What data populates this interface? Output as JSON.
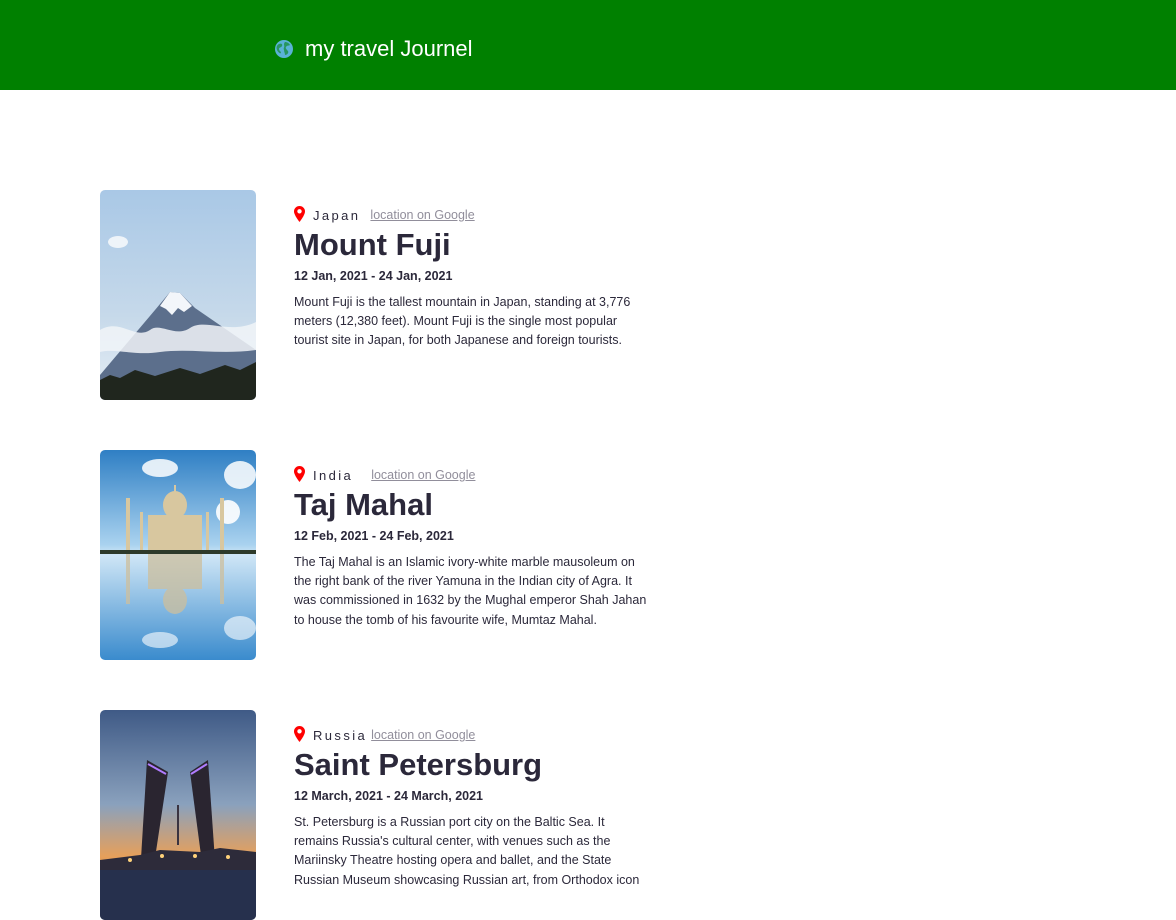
{
  "header": {
    "title": "my travel Journel",
    "icon": "globe-icon",
    "background_color": "#008000"
  },
  "entries": [
    {
      "country": "Japan",
      "map_link": "location on Google",
      "title": "Mount Fuji",
      "dates": "12 Jan, 2021 - 24 Jan, 2021",
      "description": "Mount Fuji is the tallest mountain in Japan, standing at 3,776 meters (12,380 feet). Mount Fuji is the single most popular tourist site in Japan, for both Japanese and foreign tourists.",
      "image": "mount-fuji-photo"
    },
    {
      "country": "India",
      "map_link": "location on Google",
      "title": "Taj Mahal",
      "dates": "12 Feb, 2021 - 24 Feb, 2021",
      "description": "The Taj Mahal is an Islamic ivory-white marble mausoleum on the right bank of the river Yamuna in the Indian city of Agra. It was commissioned in 1632 by the Mughal emperor Shah Jahan to house the tomb of his favourite wife, Mumtaz Mahal.",
      "image": "taj-mahal-photo"
    },
    {
      "country": "Russia",
      "map_link": "location on Google",
      "title": "Saint Petersburg",
      "dates": "12 March, 2021 - 24 March, 2021",
      "description": "St. Petersburg is a Russian port city on the Baltic Sea. It remains Russia's cultural center, with venues such as the Mariinsky Theatre hosting opera and ballet, and the State Russian Museum showcasing Russian art, from Orthodox icon",
      "image": "saint-petersburg-photo"
    }
  ],
  "colors": {
    "pin": "#ff0000",
    "link": "#918e9b",
    "text": "#2b283a"
  }
}
